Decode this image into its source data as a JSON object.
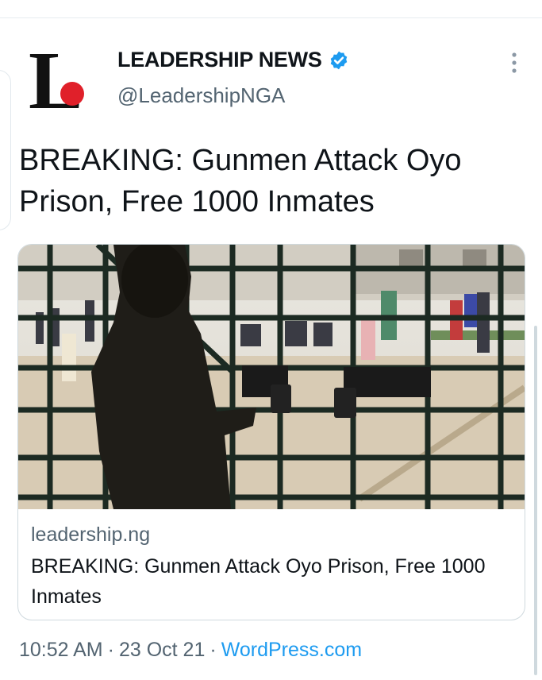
{
  "author": {
    "name": "LEADERSHIP NEWS",
    "handle": "@LeadershipNGA",
    "avatar_letter": "L",
    "verified_icon": "verified-badge-icon"
  },
  "tweet": {
    "text": "BREAKING: Gunmen Attack Oyo Prison, Free 1000 Inmates"
  },
  "card": {
    "domain": "leadership.ng",
    "title": "BREAKING: Gunmen Attack Oyo Prison, Free 1000 Inmates"
  },
  "meta": {
    "time": "10:52 AM",
    "separator": "·",
    "date": "23 Oct 21",
    "source": "WordPress.com"
  },
  "colors": {
    "accent": "#1d9bf0",
    "text": "#0f1419",
    "secondary": "#536471",
    "logo_red": "#e0202a"
  }
}
